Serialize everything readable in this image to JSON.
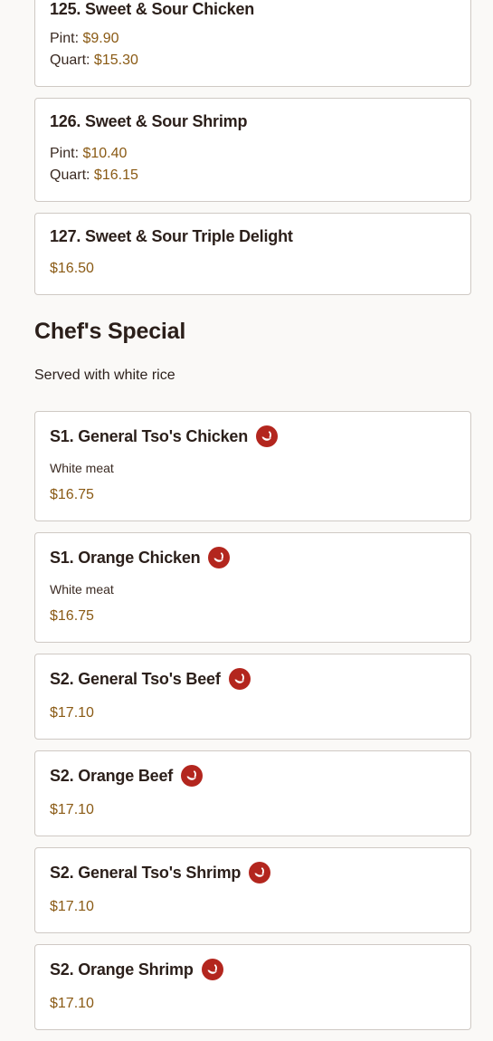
{
  "sweet_sour": [
    {
      "title": "125. Sweet & Sour Chicken",
      "pint_label": "Pint:",
      "pint_price": "$9.90",
      "quart_label": "Quart:",
      "quart_price": "$15.30"
    },
    {
      "title": "126. Sweet & Sour Shrimp",
      "pint_label": "Pint:",
      "pint_price": "$10.40",
      "quart_label": "Quart:",
      "quart_price": "$16.15"
    },
    {
      "title": "127. Sweet & Sour Triple Delight",
      "price": "$16.50"
    }
  ],
  "chef_special": {
    "title": "Chef's Special",
    "subtitle": "Served with white rice",
    "items": [
      {
        "title": "S1. General Tso's Chicken",
        "spicy": true,
        "desc": "White meat",
        "price": "$16.75"
      },
      {
        "title": "S1. Orange Chicken",
        "spicy": true,
        "desc": "White meat",
        "price": "$16.75"
      },
      {
        "title": "S2. General Tso's Beef",
        "spicy": true,
        "price": "$17.10"
      },
      {
        "title": "S2. Orange Beef",
        "spicy": true,
        "price": "$17.10"
      },
      {
        "title": "S2. General Tso's Shrimp",
        "spicy": true,
        "price": "$17.10"
      },
      {
        "title": "S2. Orange Shrimp",
        "spicy": true,
        "price": "$17.10"
      }
    ]
  },
  "colors": {
    "price": "#8a5a14",
    "spicy_icon": "#b3261e",
    "border": "#cfc9c4"
  },
  "icons": {
    "spicy": "chili-pepper-icon"
  }
}
